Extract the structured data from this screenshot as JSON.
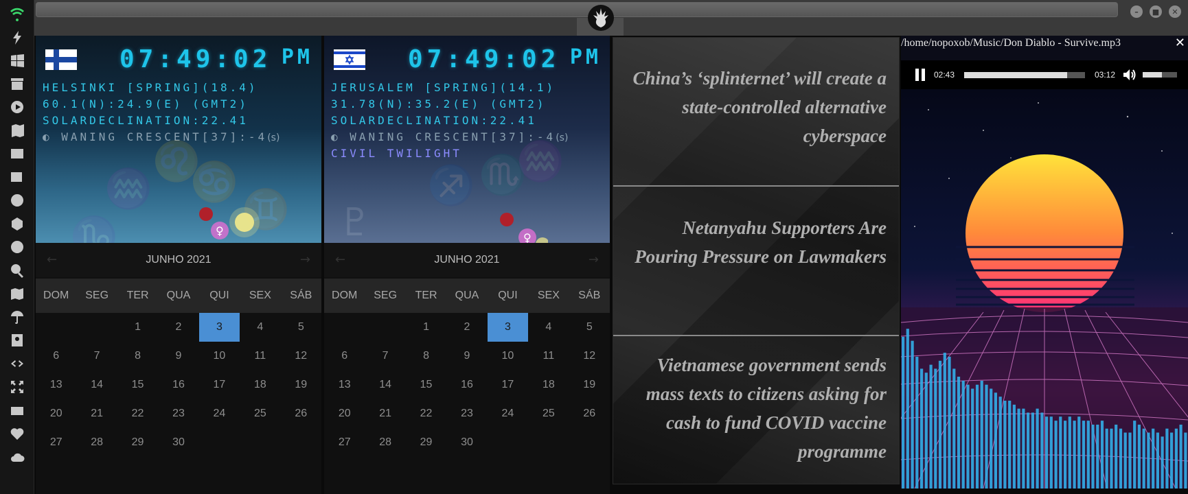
{
  "colors": {
    "clock_text": "#1ec4ea",
    "today_bg": "#4a8fd4",
    "bar_color": "#33aee8"
  },
  "sidebar": {
    "items": [
      {
        "icon": "wifi-icon"
      },
      {
        "icon": "lightning-icon"
      },
      {
        "icon": "windows-icon"
      },
      {
        "icon": "archive-icon"
      },
      {
        "icon": "play-circle-icon"
      },
      {
        "icon": "map-book-icon"
      },
      {
        "icon": "image-icon"
      },
      {
        "icon": "newspaper-icon"
      },
      {
        "icon": "rebel-icon"
      },
      {
        "icon": "hexagon-icon"
      },
      {
        "icon": "globe-icon"
      },
      {
        "icon": "search-icon"
      },
      {
        "icon": "map-icon"
      },
      {
        "icon": "umbrella-icon"
      },
      {
        "icon": "contact-icon"
      },
      {
        "icon": "code-icon"
      },
      {
        "icon": "expand-icon"
      },
      {
        "icon": "youtube-icon"
      },
      {
        "icon": "heart-icon"
      },
      {
        "icon": "cloud-icon"
      }
    ]
  },
  "clocks": [
    {
      "flag": "finland-flag-icon",
      "time": "07:49:02",
      "ampm": "PM",
      "line1": "HELSINKI [SPRING](18.4)",
      "line2": "60.1(N):24.9(E) (GMT2)",
      "line3": "SOLARDECLINATION:22.41",
      "line4": "WANING CRESCENT[37]:-4",
      "line4_suffix": "(s)",
      "line5": ""
    },
    {
      "flag": "israel-flag-icon",
      "time": "07:49:02",
      "ampm": "PM",
      "line1": "JERUSALEM [SPRING](14.1)",
      "line2": "31.78(N):35.2(E) (GMT2)",
      "line3": "SOLARDECLINATION:22.41",
      "line4": "WANING CRESCENT[37]:-4",
      "line4_suffix": "(s)",
      "line5": "CIVIL TWILIGHT"
    }
  ],
  "calendar": {
    "title": "JUNHO 2021",
    "prev": "←",
    "next": "→",
    "weekdays": [
      "DOM",
      "SEG",
      "TER",
      "QUA",
      "QUI",
      "SEX",
      "SÁB"
    ],
    "days": [
      "",
      "",
      "1",
      "2",
      "3",
      "4",
      "5",
      "6",
      "7",
      "8",
      "9",
      "10",
      "11",
      "12",
      "13",
      "14",
      "15",
      "16",
      "17",
      "18",
      "19",
      "20",
      "21",
      "22",
      "23",
      "24",
      "25",
      "26",
      "27",
      "28",
      "29",
      "30"
    ],
    "today": "3"
  },
  "news": [
    "China’s ‘splinternet’ will create a state-controlled alternative cyberspace",
    "Netanyahu Supporters Are Pouring Pressure on Lawmakers",
    "Vietnamese government sends mass texts to citizens asking for cash to fund COVID vaccine programme"
  ],
  "player": {
    "path": "/home/nopoxob/Music/Don Diablo - Survive.mp3",
    "close": "✕",
    "current_time": "02:43",
    "duration": "03:12",
    "progress": 0.85,
    "volume": 0.55,
    "visualizer_levels": [
      0.38,
      0.4,
      0.37,
      0.33,
      0.3,
      0.29,
      0.31,
      0.3,
      0.32,
      0.34,
      0.33,
      0.3,
      0.28,
      0.27,
      0.26,
      0.25,
      0.26,
      0.27,
      0.26,
      0.25,
      0.24,
      0.23,
      0.22,
      0.22,
      0.21,
      0.2,
      0.2,
      0.19,
      0.19,
      0.2,
      0.19,
      0.18,
      0.18,
      0.17,
      0.18,
      0.17,
      0.18,
      0.17,
      0.18,
      0.17,
      0.17,
      0.16,
      0.16,
      0.17,
      0.15,
      0.15,
      0.16,
      0.15,
      0.14,
      0.14,
      0.17,
      0.16,
      0.15,
      0.14,
      0.15,
      0.14,
      0.13,
      0.15,
      0.14,
      0.15,
      0.16,
      0.14
    ]
  }
}
